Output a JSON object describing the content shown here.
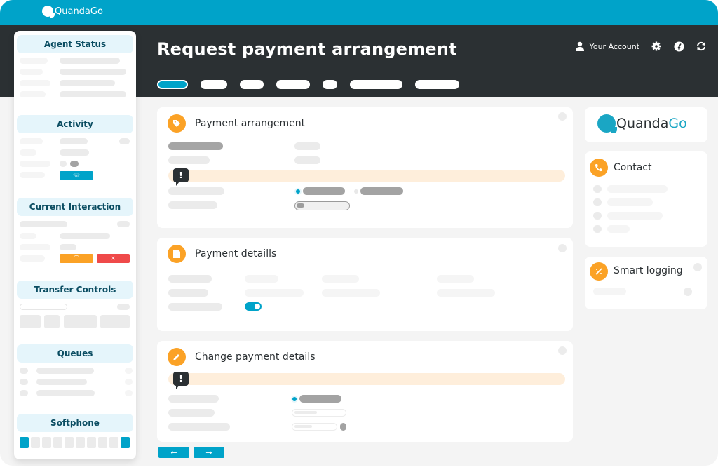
{
  "brand": {
    "name": "QuandaGo"
  },
  "header": {
    "title": "Request payment arrangement",
    "account_label": "Your Account",
    "icons": [
      "user-icon",
      "gear-icon",
      "dashboard-icon",
      "refresh-icon"
    ]
  },
  "steps": {
    "count": 7,
    "active_index": 0
  },
  "sidebar": {
    "sections": [
      {
        "title": "Agent Status"
      },
      {
        "title": "Activity"
      },
      {
        "title": "Current Interaction"
      },
      {
        "title": "Transfer Controls"
      },
      {
        "title": "Queues"
      },
      {
        "title": "Softphone"
      }
    ],
    "activity_call_icon": "phone-add-icon",
    "interaction_hold_icon": "hangup-icon",
    "interaction_end_icon": "phone-off-icon",
    "softphone_keys": 10
  },
  "cards": {
    "payment_arrangement": {
      "title": "Payment arrangement",
      "icon": "tag-icon",
      "warning_icon": "exclamation-icon",
      "progress": 0.15
    },
    "payment_details": {
      "title": "Payment detaills",
      "icon": "document-icon",
      "toggle_on": true
    },
    "change_payment_details": {
      "title": "Change payment details",
      "icon": "pencil-icon",
      "warning_icon": "exclamation-icon"
    }
  },
  "right": {
    "logo": {
      "part1": "Quanda",
      "part2": "Go"
    },
    "contact": {
      "title": "Contact",
      "icon": "phone-icon"
    },
    "smart_logging": {
      "title": "Smart logging",
      "icon": "magic-wand-icon"
    }
  },
  "nav": {
    "prev": "←",
    "next": "→"
  },
  "colors": {
    "accent": "#00a3c9",
    "header": "#2b3033",
    "orange": "#fba226",
    "red": "#ef4a4a",
    "warning_bg": "#feeedb"
  }
}
